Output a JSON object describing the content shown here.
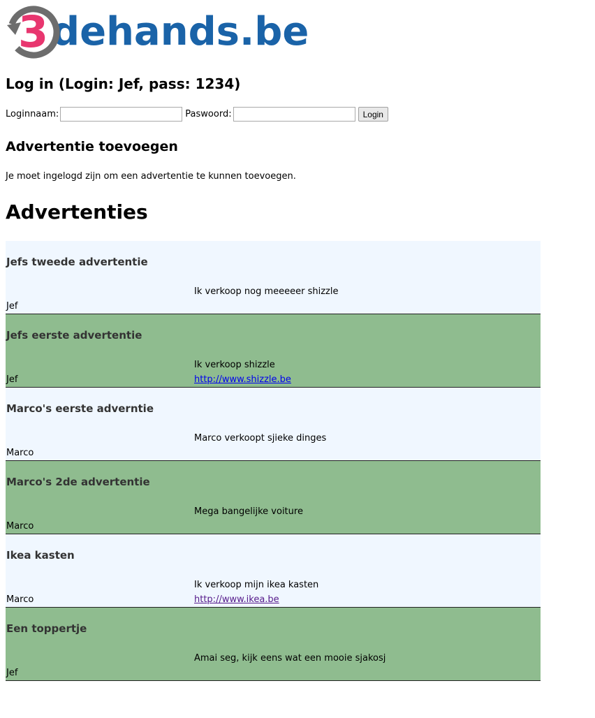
{
  "logo": {
    "mark_digit": "3",
    "text": "dehands.be"
  },
  "login": {
    "title": "Log in (Login: Jef, pass: 1234)",
    "username_label": "Loginnaam:",
    "username_value": "",
    "password_label": "Paswoord:",
    "password_value": "",
    "button_label": "Login"
  },
  "add": {
    "title": "Advertentie toevoegen",
    "note": "Je moet ingelogd zijn om een advertentie te kunnen toevoegen."
  },
  "ads": {
    "title": "Advertenties",
    "items": [
      {
        "title": "Jefs tweede advertentie",
        "description": "Ik verkoop nog meeeeer shizzle",
        "user": "Jef",
        "link": ""
      },
      {
        "title": "Jefs eerste advertentie",
        "description": "Ik verkoop shizzle",
        "user": "Jef",
        "link": "http://www.shizzle.be"
      },
      {
        "title": "Marco's eerste adverntie",
        "description": "Marco verkoopt sjieke dinges",
        "user": "Marco",
        "link": ""
      },
      {
        "title": "Marco's 2de advertentie",
        "description": "Mega bangelijke voiture",
        "user": "Marco",
        "link": ""
      },
      {
        "title": "Ikea kasten",
        "description": "Ik verkoop mijn ikea kasten",
        "user": "Marco",
        "link": "http://www.ikea.be"
      },
      {
        "title": "Een toppertje",
        "description": "Amai seg, kijk eens wat een mooie sjakosj",
        "user": "Jef",
        "link": ""
      }
    ]
  },
  "colors": {
    "row_light": "#f0f7ff",
    "row_green": "#8fbc8f",
    "logo_blue": "#1a63a8",
    "logo_pink": "#e8366f"
  }
}
